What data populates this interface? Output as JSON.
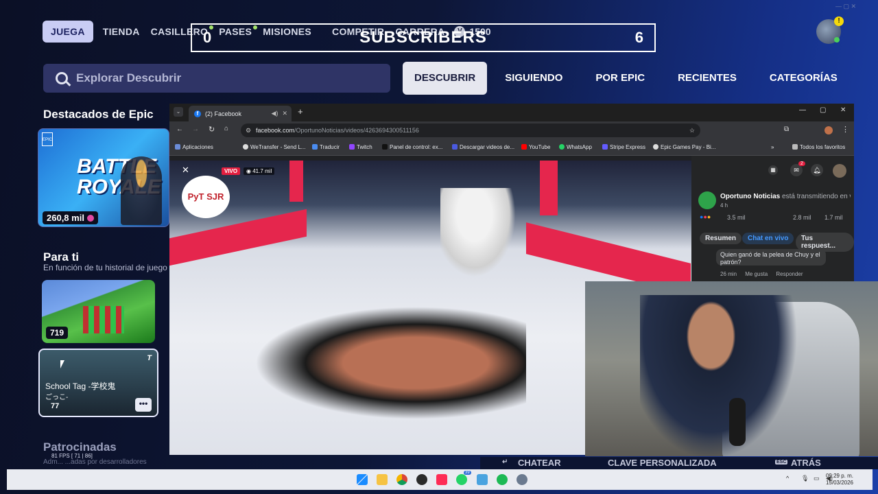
{
  "nav": {
    "items": [
      "JUEGA",
      "TIENDA",
      "CASILLERO",
      "PASES",
      "MISIONES",
      "COMPETIR",
      "CARRERA"
    ],
    "vbucks": "1500"
  },
  "overlay": {
    "left_count": "0",
    "label": "SUBSCRIBERS",
    "right_count": "6"
  },
  "search": {
    "placeholder": "Explorar Descubrir"
  },
  "tabs": [
    "DESCUBRIR",
    "SIGUIENDO",
    "POR EPIC",
    "RECIENTES",
    "CATEGORÍAS"
  ],
  "featured": {
    "title": "Destacados de Epic",
    "card_text": "BATTLE ROYALE",
    "count": "260,8 mil"
  },
  "for_you": {
    "title": "Para ti",
    "subtitle": "En función de tu historial de juego",
    "card1_count": "719",
    "card2_title": "School Tag -学校鬼",
    "card2_title2": "ごっこ-",
    "card2_count": "77",
    "card2_tag": "T"
  },
  "sponsored": {
    "title": "Patrocinadas",
    "subtitle": "Adm... ...adas por desarrolladores",
    "fps": "81 FPS [ 71 | 86]"
  },
  "browser": {
    "tab_title": "(2) Facebook",
    "url_host": "facebook.com",
    "url_path": "/OportunoNoticias/videos/4263694300511156",
    "bookmarks": [
      "Aplicaciones",
      "WeTransfer - Send L...",
      "Traducir",
      "Twitch",
      "Panel de control: ex...",
      "Descargar videos de...",
      "YouTube",
      "WhatsApp",
      "Stripe Express",
      "Epic Games Pay - Bi..."
    ],
    "bookmarks_all": "Todos los favoritos",
    "live_badge": "VIVO",
    "viewers": "41.7 mil",
    "logo_text": "PyT SJR"
  },
  "fb": {
    "page_name": "Oportuno Noticias",
    "status": "está transmitiendo en vivo",
    "time": "4 h",
    "reactions": "3.5 mil",
    "comments": "2.8 mil",
    "shares": "1.7 mil",
    "notif_count": "2",
    "pills": [
      "Resumen",
      "Chat en vivo",
      "Tus respuest..."
    ],
    "comment_text": "Quien ganó de la pelea de Chuy y el patrón?",
    "comment_time": "26 min",
    "comment_like": "Me gusta",
    "comment_reply": "Responder"
  },
  "bottom_actions": [
    "CHATEAR",
    "CLAVE PERSONALIZADA",
    "ATRÁS"
  ],
  "clock": {
    "time": "09:29 p. m.",
    "date": "15/03/2026"
  },
  "taskbar_badge": "39"
}
